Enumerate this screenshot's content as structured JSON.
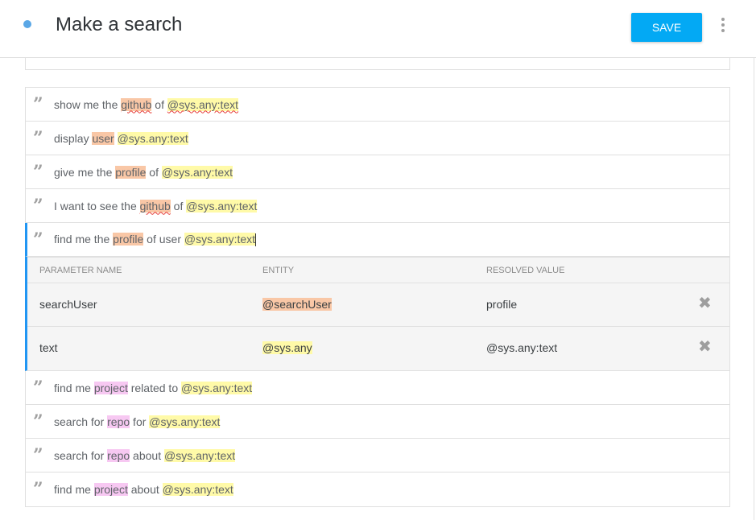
{
  "header": {
    "title": "Make a search",
    "save_label": "SAVE"
  },
  "colors": {
    "accent": "#03a9f4",
    "status_dot": "#5aa7e6",
    "active_bar": "#2196f3",
    "sys_highlight": "#fffaa8",
    "entity_highlight": "#f9c7a6",
    "custom_highlight": "#f7c8f2"
  },
  "phrases": [
    {
      "tokens": [
        {
          "t": "show me the "
        },
        {
          "t": "github",
          "hl": "org",
          "sq": true
        },
        {
          "t": " of "
        },
        {
          "t": "@sys.any:text",
          "hl": "sys",
          "sq": true
        }
      ]
    },
    {
      "tokens": [
        {
          "t": "display "
        },
        {
          "t": "user",
          "hl": "org"
        },
        {
          "t": " "
        },
        {
          "t": "@sys.any:text",
          "hl": "sys"
        }
      ]
    },
    {
      "tokens": [
        {
          "t": "give me the "
        },
        {
          "t": "profile",
          "hl": "org"
        },
        {
          "t": " of "
        },
        {
          "t": "@sys.any:text",
          "hl": "sys"
        }
      ]
    },
    {
      "tokens": [
        {
          "t": "I want to see the "
        },
        {
          "t": "github",
          "hl": "org",
          "sq": true
        },
        {
          "t": " of "
        },
        {
          "t": "@sys.any:text",
          "hl": "sys"
        }
      ]
    },
    {
      "tokens": [
        {
          "t": "find me the "
        },
        {
          "t": "profile",
          "hl": "org"
        },
        {
          "t": " of user "
        },
        {
          "t": "@sys.any:text",
          "hl": "sys"
        }
      ],
      "active": true
    },
    {
      "tokens": [
        {
          "t": "find me "
        },
        {
          "t": "project",
          "hl": "pink"
        },
        {
          "t": " related to "
        },
        {
          "t": "@sys.any:text",
          "hl": "sys"
        }
      ]
    },
    {
      "tokens": [
        {
          "t": "search for "
        },
        {
          "t": "repo",
          "hl": "pink"
        },
        {
          "t": " for "
        },
        {
          "t": "@sys.any:text",
          "hl": "sys"
        }
      ]
    },
    {
      "tokens": [
        {
          "t": "search for "
        },
        {
          "t": "repo",
          "hl": "pink"
        },
        {
          "t": " about "
        },
        {
          "t": "@sys.any:text",
          "hl": "sys"
        }
      ]
    },
    {
      "tokens": [
        {
          "t": "find me "
        },
        {
          "t": "project",
          "hl": "pink"
        },
        {
          "t": " about "
        },
        {
          "t": "@sys.any:text",
          "hl": "sys"
        }
      ]
    }
  ],
  "params": {
    "headers": [
      "PARAMETER NAME",
      "ENTITY",
      "RESOLVED VALUE"
    ],
    "rows": [
      {
        "name": "searchUser",
        "entity": "@searchUser",
        "entity_hl": "org",
        "value": "profile"
      },
      {
        "name": "text",
        "entity": "@sys.any",
        "entity_hl": "sys",
        "value": "@sys.any:text"
      }
    ]
  },
  "icons": {
    "quote": "quote-icon",
    "delete": "close-icon",
    "more": "more-vert-icon"
  }
}
